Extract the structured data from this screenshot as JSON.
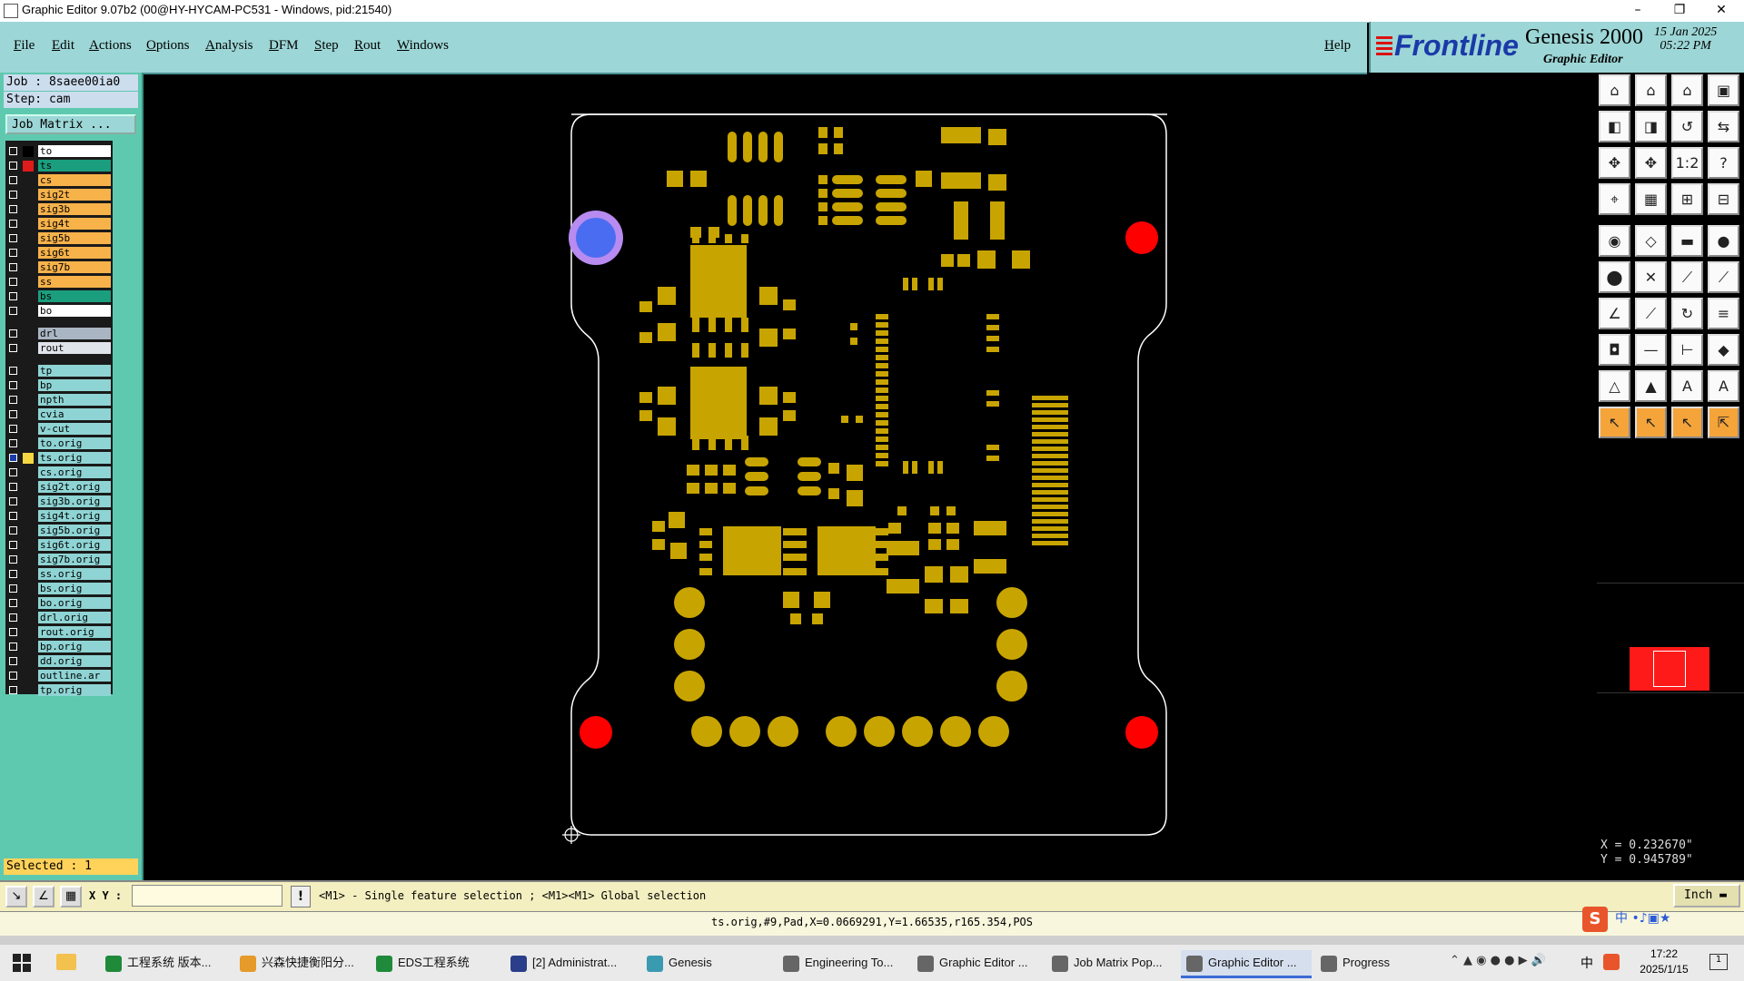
{
  "window": {
    "title": "Graphic Editor 9.07b2 (00@HY-HYCAM-PC531 - Windows, pid:21540)"
  },
  "menu": [
    "File",
    "Edit",
    "Actions",
    "Options",
    "Analysis",
    "DFM",
    "Step",
    "Rout",
    "Windows"
  ],
  "help": "Help",
  "logo": {
    "brand": "Frontline",
    "product": "Genesis 2000",
    "subtitle": "Graphic Editor",
    "date": "15 Jan 2025",
    "time": "05:22 PM"
  },
  "job": {
    "job": "Job : 8saee00ia0",
    "step": "Step: cam",
    "matrix_button": "Job Matrix ..."
  },
  "layers": [
    {
      "name": "to",
      "bg": "#ffffff",
      "color": "#000000"
    },
    {
      "name": "ts",
      "bg": "#1a9e7e",
      "color": "#e01b1b"
    },
    {
      "name": "cs",
      "bg": "#f7b24a",
      "color": ""
    },
    {
      "name": "sig2t",
      "bg": "#f7b24a",
      "color": ""
    },
    {
      "name": "sig3b",
      "bg": "#f7b24a",
      "color": ""
    },
    {
      "name": "sig4t",
      "bg": "#f7b24a",
      "color": ""
    },
    {
      "name": "sig5b",
      "bg": "#f7b24a",
      "color": ""
    },
    {
      "name": "sig6t",
      "bg": "#f7b24a",
      "color": ""
    },
    {
      "name": "sig7b",
      "bg": "#f7b24a",
      "color": ""
    },
    {
      "name": "ss",
      "bg": "#f7b24a",
      "color": ""
    },
    {
      "name": "bs",
      "bg": "#1a9e7e",
      "color": ""
    },
    {
      "name": "bo",
      "bg": "#ffffff",
      "color": ""
    },
    {
      "name": "drl",
      "bg": "#a9b5c2",
      "color": ""
    },
    {
      "name": "rout",
      "bg": "#dfe4ea",
      "color": ""
    },
    {
      "name": "tp",
      "bg": "#8fd4d4",
      "color": ""
    },
    {
      "name": "bp",
      "bg": "#8fd4d4",
      "color": ""
    },
    {
      "name": "npth",
      "bg": "#8fd4d4",
      "color": ""
    },
    {
      "name": "cvia",
      "bg": "#8fd4d4",
      "color": ""
    },
    {
      "name": "v-cut",
      "bg": "#8fd4d4",
      "color": ""
    },
    {
      "name": "to.orig",
      "bg": "#8fd4d4",
      "color": ""
    },
    {
      "name": "ts.orig",
      "bg": "#8fd4d4",
      "color": "#f5d742"
    },
    {
      "name": "cs.orig",
      "bg": "#8fd4d4",
      "color": ""
    },
    {
      "name": "sig2t.orig",
      "bg": "#8fd4d4",
      "color": ""
    },
    {
      "name": "sig3b.orig",
      "bg": "#8fd4d4",
      "color": ""
    },
    {
      "name": "sig4t.orig",
      "bg": "#8fd4d4",
      "color": ""
    },
    {
      "name": "sig5b.orig",
      "bg": "#8fd4d4",
      "color": ""
    },
    {
      "name": "sig6t.orig",
      "bg": "#8fd4d4",
      "color": ""
    },
    {
      "name": "sig7b.orig",
      "bg": "#8fd4d4",
      "color": ""
    },
    {
      "name": "ss.orig",
      "bg": "#8fd4d4",
      "color": ""
    },
    {
      "name": "bs.orig",
      "bg": "#8fd4d4",
      "color": ""
    },
    {
      "name": "bo.orig",
      "bg": "#8fd4d4",
      "color": ""
    },
    {
      "name": "drl.orig",
      "bg": "#8fd4d4",
      "color": ""
    },
    {
      "name": "rout.orig",
      "bg": "#8fd4d4",
      "color": ""
    },
    {
      "name": "bp.orig",
      "bg": "#8fd4d4",
      "color": ""
    },
    {
      "name": "dd.orig",
      "bg": "#8fd4d4",
      "color": ""
    },
    {
      "name": "outline.ar",
      "bg": "#8fd4d4",
      "color": ""
    },
    {
      "name": "tp.orig",
      "bg": "#8fd4d4",
      "color": ""
    }
  ],
  "selected": "Selected : 1",
  "coords": {
    "x": "X = 0.232670\"",
    "y": "Y = 0.945789\""
  },
  "cmd": {
    "xy_label": "X Y :",
    "xy_value": "",
    "hint": "<M1> - Single feature selection ; <M1><M1> Global selection",
    "units": "Inch"
  },
  "status": "ts.orig,#9,Pad,X=0.0669291,Y=1.66535,r165.354,POS",
  "taskbar": [
    {
      "label": "工程系统  版本...",
      "icon": "#1e8a3a"
    },
    {
      "label": "兴森快捷衡阳分...",
      "icon": "#e59a2a"
    },
    {
      "label": "EDS工程系统",
      "icon": "#1e8a3a"
    },
    {
      "label": "[2] Administrat...",
      "icon": "#2a3e8a"
    },
    {
      "label": "Genesis",
      "icon": "#3a9ab0"
    },
    {
      "label": "Engineering To...",
      "icon": "#666666"
    },
    {
      "label": "Graphic Editor ...",
      "icon": "#666666"
    },
    {
      "label": "Job Matrix Pop...",
      "icon": "#666666"
    },
    {
      "label": "Graphic Editor ...",
      "icon": "#666666"
    },
    {
      "label": "Progress",
      "icon": "#666666"
    }
  ],
  "clock": {
    "time": "17:22",
    "date": "2025/1/15"
  },
  "ime": "中",
  "colors": {
    "copper": "#c8a400",
    "outline": "#ffffff",
    "drill": "#ff0000",
    "highlight": "#5b7df0"
  }
}
